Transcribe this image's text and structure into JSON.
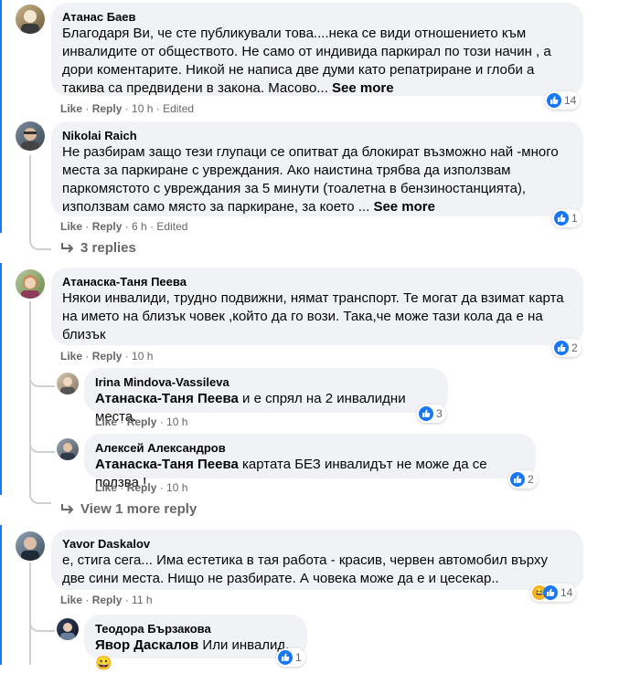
{
  "actions": {
    "like": "Like",
    "reply": "Reply",
    "edited": "Edited"
  },
  "comments": [
    {
      "name": "Атанас Баев",
      "text": "Благодаря Ви, че сте публикували това....нека се види отношението към инвалидите от обществото. Не само от индивида паркирал по този начин , а дори коментарите. Никой не написа две думи като репатриране и глоби а такива са предвидени в закона. Масово...",
      "see_more": "See more",
      "time": "10 h",
      "reactions": "14"
    },
    {
      "name": "Nikolai Raich",
      "text": "Не разбирам защо тези глупаци се опитват да блокират възможно най -много места за паркиране с увреждания. Ако наистина трябва да използвам паркомястото с увреждания за 5 минути (тоалетна в бензиностанцията), използвам само място за паркиране, за което ...",
      "see_more": "See more",
      "time": "6 h",
      "reactions": "1",
      "replies_link": "3 replies"
    },
    {
      "name": "Атанаска-Таня Пеева",
      "text": "Някои инвалиди, трудно подвижни, нямат транспорт. Те могат да взимат карта на името на близък човек ,който да го вози. Така,че може тази кола да е на близък",
      "time": "10 h",
      "reactions": "2",
      "replies": [
        {
          "name": "Irina Mindova-Vassileva",
          "mention": "Атанаска-Таня Пеева",
          "text": "и е спрял на 2 инвалидни места.",
          "time": "10 h",
          "reactions": "3"
        },
        {
          "name": "Алексей Александров",
          "mention": "Атанаска-Таня Пеева",
          "text": "картата БЕЗ инвалидът не може да се ползва !",
          "time": "10 h",
          "reactions": "2"
        }
      ],
      "more_link": "View 1 more reply"
    },
    {
      "name": "Yavor Daskalov",
      "text": "е, стига сега... Има естетика в тая работа - красив, червен автомобил върху две сини места. Нищо не разбирате. А човека може да е и цесекар..",
      "time": "11 h",
      "reactions": "14",
      "replies": [
        {
          "name": "Теодора Бързакова",
          "mention": "Явор Даскалов",
          "text": "Или инвалид.",
          "emoji": "😀",
          "reactions": "1"
        }
      ]
    }
  ]
}
